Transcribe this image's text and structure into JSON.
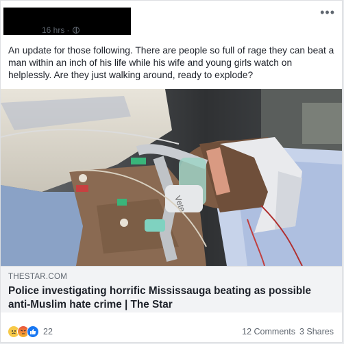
{
  "post": {
    "time": "16 hrs",
    "separator": "·",
    "text": "An update for those following. There are people so full of rage they can beat a man within an inch of his life while his wife and young girls watch on helplessly. Are they just walking around, ready to explode?"
  },
  "icons": {
    "globe": "globe-icon",
    "more": "more-options-icon",
    "reactions": [
      "sad-reaction-icon",
      "angry-reaction-icon",
      "like-reaction-icon"
    ]
  },
  "link": {
    "domain": "THESTAR.COM",
    "headline": "Police investigating horrific Mississauga beating as possible anti-Muslim hate crime | The Star"
  },
  "photo": {
    "tube_print": "Vete"
  },
  "footer": {
    "reaction_count": "22",
    "comments": "12 Comments",
    "shares": "3 Shares"
  }
}
